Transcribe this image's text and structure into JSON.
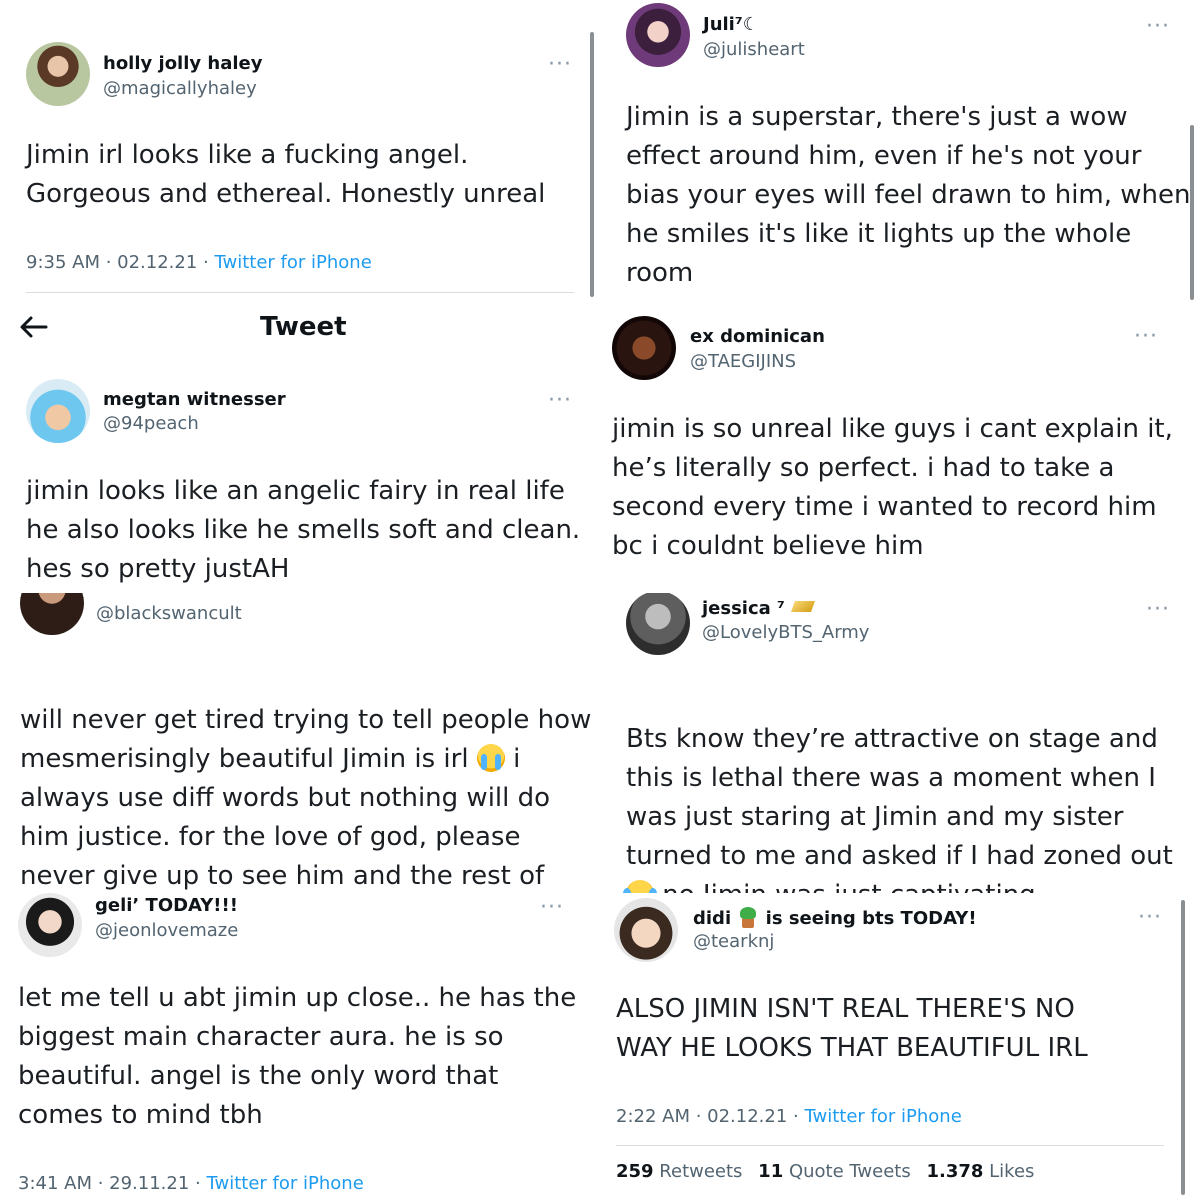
{
  "t1": {
    "name": "holly jolly haley",
    "handle": "@magicallyhaley",
    "text": "Jimin irl looks like a fucking angel.\nGorgeous and ethereal. Honestly unreal",
    "time": "9:35 AM · 02.12.21 · ",
    "source": "Twitter for iPhone",
    "more": "···"
  },
  "t2": {
    "name": "Juli⁷☾",
    "handle": "@julisheart",
    "text": "Jimin is a superstar, there's just a wow\neffect around him, even if he's not your\nbias your eyes will feel drawn to him, when\nhe smiles it's like it lights up the whole\nroom",
    "more": "···"
  },
  "t3": {
    "header_title": "Tweet",
    "back_icon": "arrow-left-icon",
    "name": "megtan witnesser",
    "handle": "@94peach",
    "text": "jimin looks like an angelic fairy in real life\nhe also looks like he smells soft and clean.\nhes so pretty justAH",
    "more": "···"
  },
  "t4": {
    "name": "ex dominican",
    "handle": "@TAEGIJINS",
    "text": "jimin is so unreal like guys i cant explain it,\nhe’s literally so perfect. i had to take a\nsecond every time i wanted to record him\nbc i couldnt believe him",
    "more": "···"
  },
  "t5": {
    "handle": "@blackswancult",
    "text_a": "will never get tired trying to tell people how\nmesmerisingly beautiful Jimin is irl ",
    "emoji": "crying-face-emoji",
    "text_b": " i\nalways use diff words but nothing will do\nhim justice. for the love of god, please\nnever give up to see him and the rest of\nbangtan in concerts!"
  },
  "t6": {
    "name": "jessica ⁷",
    "name_emoji": "gold-bar-emoji",
    "handle": "@LovelyBTS_Army",
    "text_a": "Bts know they’re attractive on stage and\nthis is lethal there was a moment when I\nwas just staring at Jimin and my sister\nturned to me and asked if I had zoned out\n",
    "emoji": "laughing-tears-emoji",
    "text_b": " no Jimin was just captivating",
    "more": "···"
  },
  "t7": {
    "name": "geli’ TODAY!!!",
    "handle": "@jeonlovemaze",
    "text": "let me tell u abt jimin up close.. he has the\nbiggest main character aura. he is so\nbeautiful. angel is the only word that\ncomes to mind tbh",
    "time": "3:41 AM · 29.11.21 · ",
    "source": "Twitter for iPhone",
    "more": "···"
  },
  "t8": {
    "name_a": "didi ",
    "name_emoji": "potted-plant-emoji",
    "name_b": " is seeing bts TODAY!",
    "handle": "@tearknj",
    "text": "ALSO JIMIN ISN'T REAL THERE'S NO\nWAY HE LOOKS THAT BEAUTIFUL IRL",
    "time": "2:22 AM · 02.12.21 · ",
    "source": "Twitter for iPhone",
    "retweets_count": "259",
    "retweets_label": " Retweets",
    "quotes_count": "11",
    "quotes_label": " Quote Tweets",
    "likes_count": "1.378",
    "likes_label": " Likes",
    "more": "···"
  },
  "colors": {
    "link": "#1d9bf0",
    "secondary": "#536471",
    "text": "#0f1419"
  }
}
